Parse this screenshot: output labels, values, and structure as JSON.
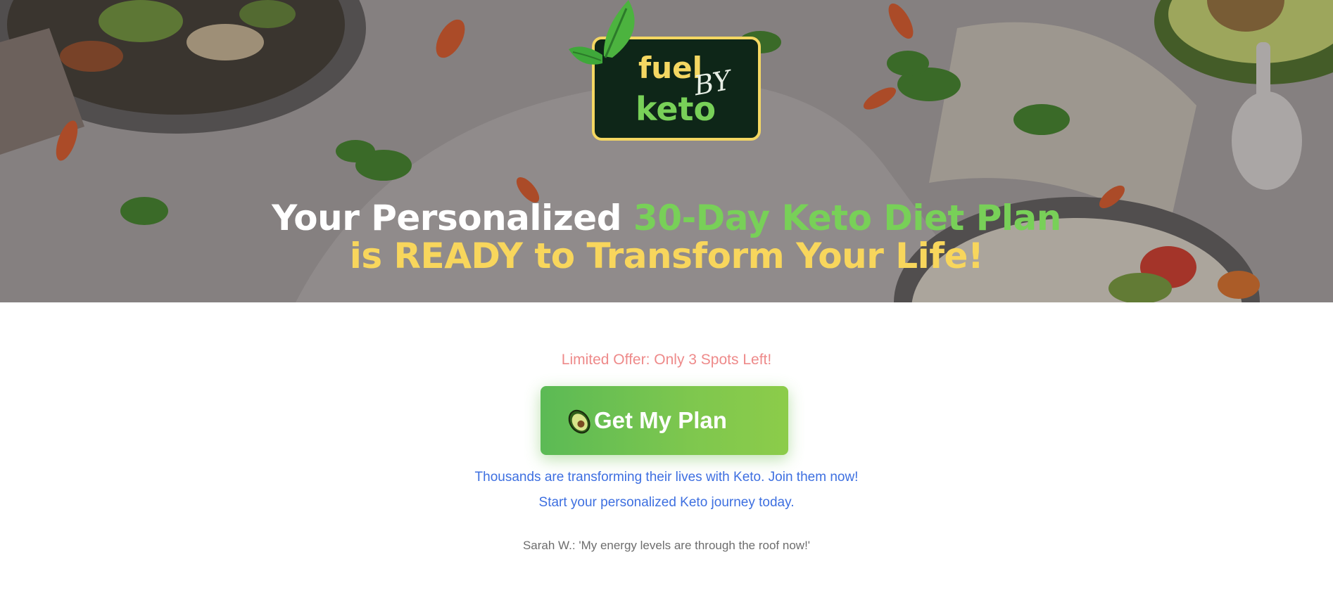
{
  "logo": {
    "word1": "fuel",
    "word2": "BY",
    "word3": "keto"
  },
  "hero": {
    "headline_part1": "Your Personalized ",
    "headline_part2": "30-Day Keto Diet Plan",
    "headline_part3": "is READY to Transform Your Life!"
  },
  "offer": {
    "text": "Limited Offer: Only 3 Spots Left!"
  },
  "cta": {
    "icon": "avocado-icon",
    "label": "Get My Plan"
  },
  "social_proof": {
    "line1": "Thousands are transforming their lives with Keto. Join them now!",
    "line2": "Start your personalized Keto journey today."
  },
  "testimonial": {
    "text": "Sarah W.: 'My energy levels are through the roof now!'"
  },
  "colors": {
    "brand_green": "#78d058",
    "brand_yellow": "#f8d65c",
    "offer_red": "#ee8a8a",
    "link_blue": "#3d6fe0"
  }
}
